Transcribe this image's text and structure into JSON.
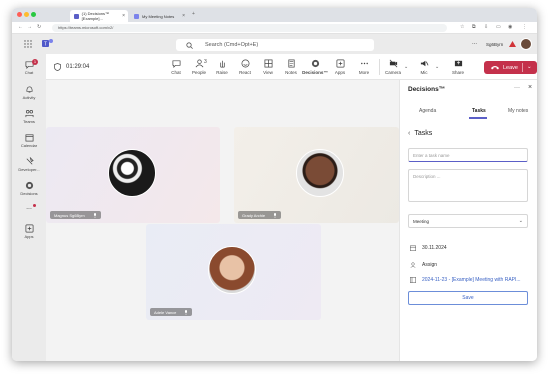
{
  "browser": {
    "tabs": [
      {
        "label": "(1) Decisions™ [Example]...",
        "active": true
      },
      {
        "label": "My Meeting Notes",
        "active": false
      }
    ],
    "new_tab": "+",
    "url": "https://teams.microsoft.com/v2/"
  },
  "teams": {
    "search_placeholder": "Search (Cmd+Opt+E)",
    "more": "...",
    "user_name": "Sg6Byrn",
    "rail": [
      {
        "label": "Chat",
        "icon": "chat-icon",
        "badge": "1"
      },
      {
        "label": "Activity",
        "icon": "bell-icon"
      },
      {
        "label": "Teams",
        "icon": "teams-icon"
      },
      {
        "label": "Calendar",
        "icon": "calendar-icon"
      },
      {
        "label": "Developer...",
        "icon": "developer-icon"
      },
      {
        "label": "Decisions",
        "icon": "decisions-icon"
      },
      {
        "label": "...",
        "icon": "more-icon"
      },
      {
        "label": "Apps",
        "icon": "apps-icon"
      }
    ]
  },
  "meeting": {
    "timer": "01:29:04",
    "toolbar": [
      {
        "label": "Chat",
        "icon": "chat-icon"
      },
      {
        "label": "People",
        "icon": "people-icon",
        "count": "3"
      },
      {
        "label": "Raise",
        "icon": "hand-icon"
      },
      {
        "label": "React",
        "icon": "smile-icon"
      },
      {
        "label": "View",
        "icon": "grid-icon"
      },
      {
        "label": "Notes",
        "icon": "notes-icon"
      },
      {
        "label": "Decisions™",
        "icon": "decisions-icon"
      },
      {
        "label": "Apps",
        "icon": "apps-icon"
      },
      {
        "label": "More",
        "icon": "more-icon"
      },
      {
        "label": "Camera",
        "icon": "camera-off-icon"
      },
      {
        "label": "Mic",
        "icon": "mic-icon"
      },
      {
        "label": "Share",
        "icon": "share-icon"
      }
    ],
    "leave_label": "Leave",
    "participants": [
      {
        "name": "Magnus Sg6Byrn"
      },
      {
        "name": "Grady Archie"
      },
      {
        "name": "Adele Vance"
      }
    ]
  },
  "panel": {
    "title": "Decisions™",
    "tabs": [
      "Agenda",
      "Tasks",
      "My notes"
    ],
    "active_tab": "Tasks",
    "section_title": "Tasks",
    "task_name_placeholder": "Enter a task name",
    "description_placeholder": "Description ...",
    "meeting_select": "Meeting",
    "date": "30.11.2024",
    "assign": "Assign",
    "meeting_link": "2024-11-23 - [Example] Meeting with RAPI...",
    "save_label": "Save"
  },
  "colors": {
    "accent": "#5b5fc7",
    "leave": "#c4314b",
    "link": "#3a62c4"
  }
}
